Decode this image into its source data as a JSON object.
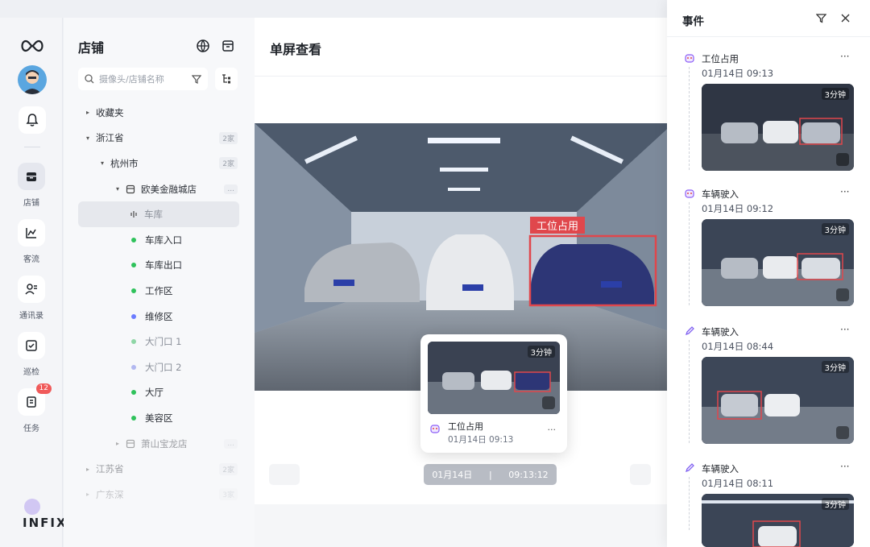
{
  "rail": {
    "nav": [
      {
        "label": "店铺",
        "icon": "store-icon"
      },
      {
        "label": "客流",
        "icon": "chart-icon"
      },
      {
        "label": "通讯录",
        "icon": "contacts-icon"
      },
      {
        "label": "巡检",
        "icon": "check-icon"
      },
      {
        "label": "任务",
        "icon": "task-icon",
        "badge": "12"
      }
    ],
    "brand": "INFIXIGHT"
  },
  "stores": {
    "title": "店铺",
    "search_placeholder": "摄像头/店铺名称",
    "tree": [
      {
        "label": "收藏夹",
        "arrow": "▸",
        "level": 0
      },
      {
        "label": "浙江省",
        "arrow": "▾",
        "level": 0,
        "count": "2家"
      },
      {
        "label": "杭州市",
        "arrow": "▾",
        "level": 1,
        "count": "2家"
      },
      {
        "label": "欧美金融城店",
        "arrow": "▾",
        "level": 2,
        "count": "..."
      },
      {
        "label": "车库",
        "level": 3,
        "selected": true
      },
      {
        "label": "车库入口",
        "level": 3,
        "dot": "#2fc25b"
      },
      {
        "label": "车库出口",
        "level": 3,
        "dot": "#2fc25b"
      },
      {
        "label": "工作区",
        "level": 3,
        "dot": "#2fc25b"
      },
      {
        "label": "维修区",
        "level": 3,
        "dot": "#6b7cff"
      },
      {
        "label": "大门口 1",
        "level": 3,
        "dot": "#8fd6a6"
      },
      {
        "label": "大门口 2",
        "level": 3,
        "dot": "#b2b8f0"
      },
      {
        "label": "大厅",
        "level": 3,
        "dot": "#2fc25b"
      },
      {
        "label": "美容区",
        "level": 3,
        "dot": "#2fc25b"
      },
      {
        "label": "萧山宝龙店",
        "arrow": "▸",
        "level": 2,
        "count": "..."
      },
      {
        "label": "江苏省",
        "arrow": "▸",
        "level": 0,
        "count": "2家"
      },
      {
        "label": "广东深",
        "arrow": "▸",
        "level": 0,
        "count": "3家"
      }
    ]
  },
  "main": {
    "title": "单屏查看",
    "overlay_label": "工位占用",
    "date": "01月14日",
    "time": "09:13:12",
    "popup": {
      "event": "工位占用",
      "time": "01月14日 09:13",
      "duration": "3分钟"
    }
  },
  "events": {
    "title": "事件",
    "items": [
      {
        "name": "工位占用",
        "time": "01月14日 09:13",
        "duration": "3分钟",
        "icon": "robot-icon"
      },
      {
        "name": "车辆驶入",
        "time": "01月14日 09:12",
        "duration": "3分钟",
        "icon": "robot-icon"
      },
      {
        "name": "车辆驶入",
        "time": "01月14日 08:44",
        "duration": "3分钟",
        "icon": "pen-icon"
      },
      {
        "name": "车辆驶入",
        "time": "01月14日 08:11",
        "duration": "3分钟",
        "icon": "pen-icon"
      }
    ]
  }
}
